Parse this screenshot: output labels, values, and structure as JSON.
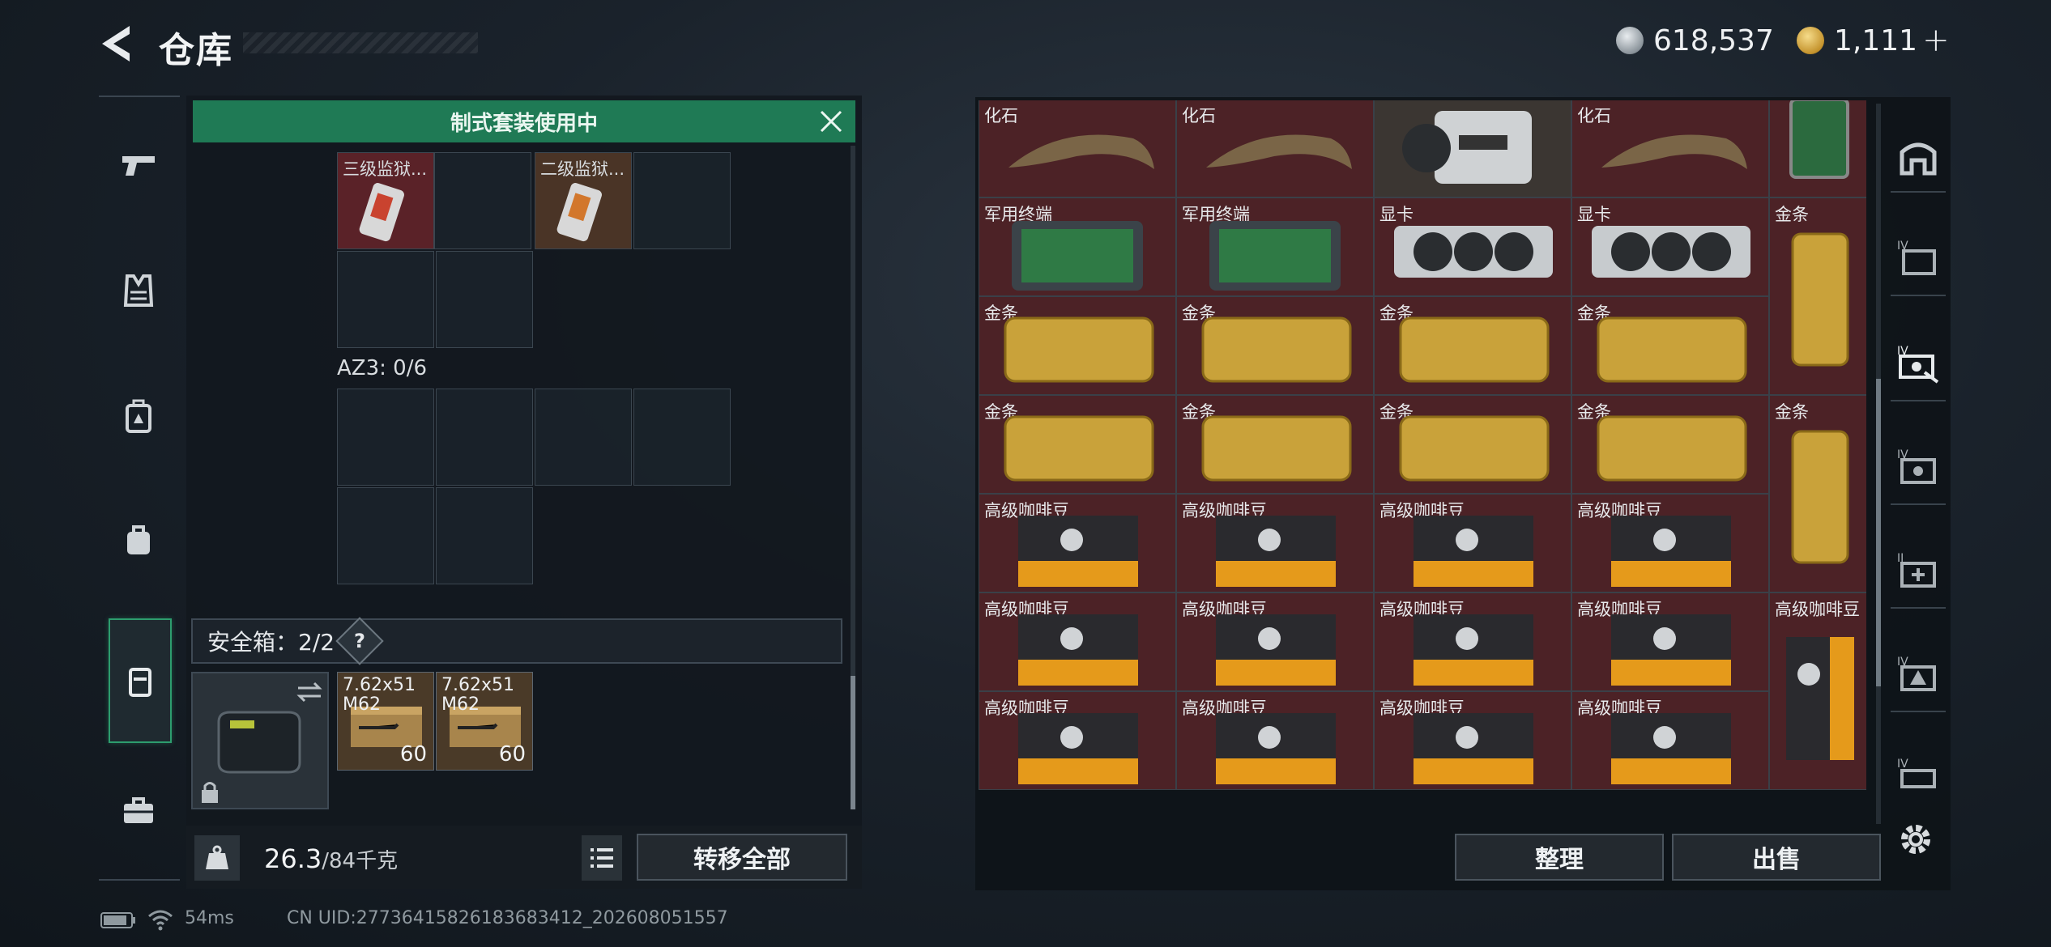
{
  "header": {
    "title": "仓库"
  },
  "currency": [
    {
      "name": "silver",
      "value": "618,537"
    },
    {
      "name": "gold",
      "value": "1,111",
      "plus": "+"
    }
  ],
  "left_tabs": [
    "pistol-icon",
    "vest-icon",
    "backpack-tactical-icon",
    "backpack-icon",
    "chest-rig-icon",
    "toolbox-icon"
  ],
  "loadout": {
    "banner": "制式套装使用中",
    "top_items": [
      {
        "label": "三级监狱...",
        "bg": "#5a2228"
      },
      {
        "label": "二级监狱...",
        "bg": "#4a3426"
      }
    ],
    "az3_label": "AZ3: 0/6",
    "safebox_label": "安全箱：2/2",
    "help": "?",
    "ammo": [
      {
        "label": "7.62x51",
        "label2": "M62",
        "qty": "60"
      },
      {
        "label": "7.62x51",
        "label2": "M62",
        "qty": "60"
      }
    ],
    "weight_current": "26.3",
    "weight_max": "/84千克",
    "transfer_all": "转移全部"
  },
  "stash": {
    "rows": [
      [
        "化石",
        "化石",
        "",
        "化石"
      ],
      [
        "军用终端",
        "军用终端",
        "显卡",
        "显卡",
        "金条"
      ],
      [
        "金条",
        "金条",
        "金条",
        "金条"
      ],
      [
        "金条",
        "金条",
        "金条",
        "金条",
        "金条"
      ],
      [
        "高级咖啡豆",
        "高级咖啡豆",
        "高级咖啡豆",
        "高级咖啡豆"
      ],
      [
        "高级咖啡豆",
        "高级咖啡豆",
        "高级咖啡豆",
        "高级咖啡豆",
        "高级咖啡豆"
      ],
      [
        "高级咖啡豆",
        "高级咖啡豆",
        "高级咖啡豆",
        "高级咖啡豆"
      ]
    ],
    "sort_label": "整理",
    "sell_label": "出售"
  },
  "right_tabs": [
    "base-icon",
    "tier-iv-case-icon",
    "tier-iv-key-icon",
    "tier-iv-key-case-icon",
    "tier-ii-medical-icon",
    "tier-iv-ammo-icon",
    "tier-iv-misc-icon"
  ],
  "status": {
    "ping": "54ms",
    "uid": "CN UID:27736415826183683412_202608051557"
  },
  "colors": {
    "accent_green": "#1f7a55",
    "red_bg": "#4c2226",
    "gold": "#c9a23a"
  }
}
